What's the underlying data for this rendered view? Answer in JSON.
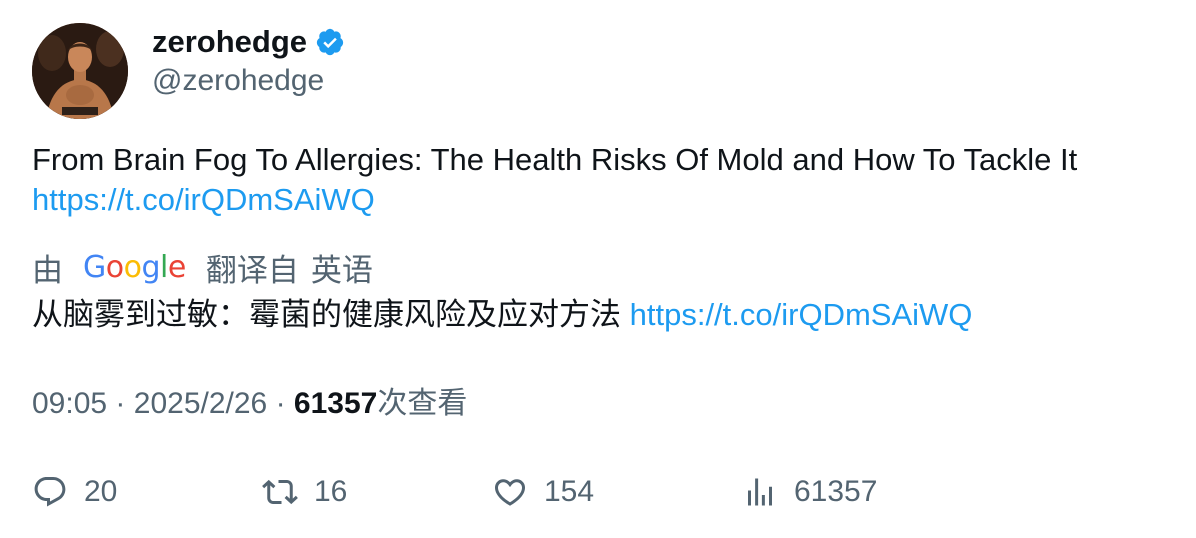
{
  "author": {
    "display_name": "zerohedge",
    "handle": "@zerohedge",
    "verified": true,
    "verified_color": "#1d9bf0",
    "avatar_icon": "avatar-photo"
  },
  "tweet": {
    "text": "From Brain Fog To Allergies: The Health Risks Of Mold and How To Tackle It",
    "link": "https://t.co/irQDmSAiWQ",
    "link_color": "#1d9bf0"
  },
  "translation": {
    "by_label": "由",
    "provider": "Google",
    "from_label": "翻译自",
    "language": "英语",
    "text": "从脑雾到过敏：霉菌的健康风险及应对方法",
    "link": "https://t.co/irQDmSAiWQ"
  },
  "meta": {
    "time": "09:05",
    "separator": "·",
    "date": "2025/2/26",
    "views_count": "61357",
    "views_label": "次查看"
  },
  "actions": {
    "reply_count": "20",
    "retweet_count": "16",
    "like_count": "154",
    "views_count": "61357"
  }
}
